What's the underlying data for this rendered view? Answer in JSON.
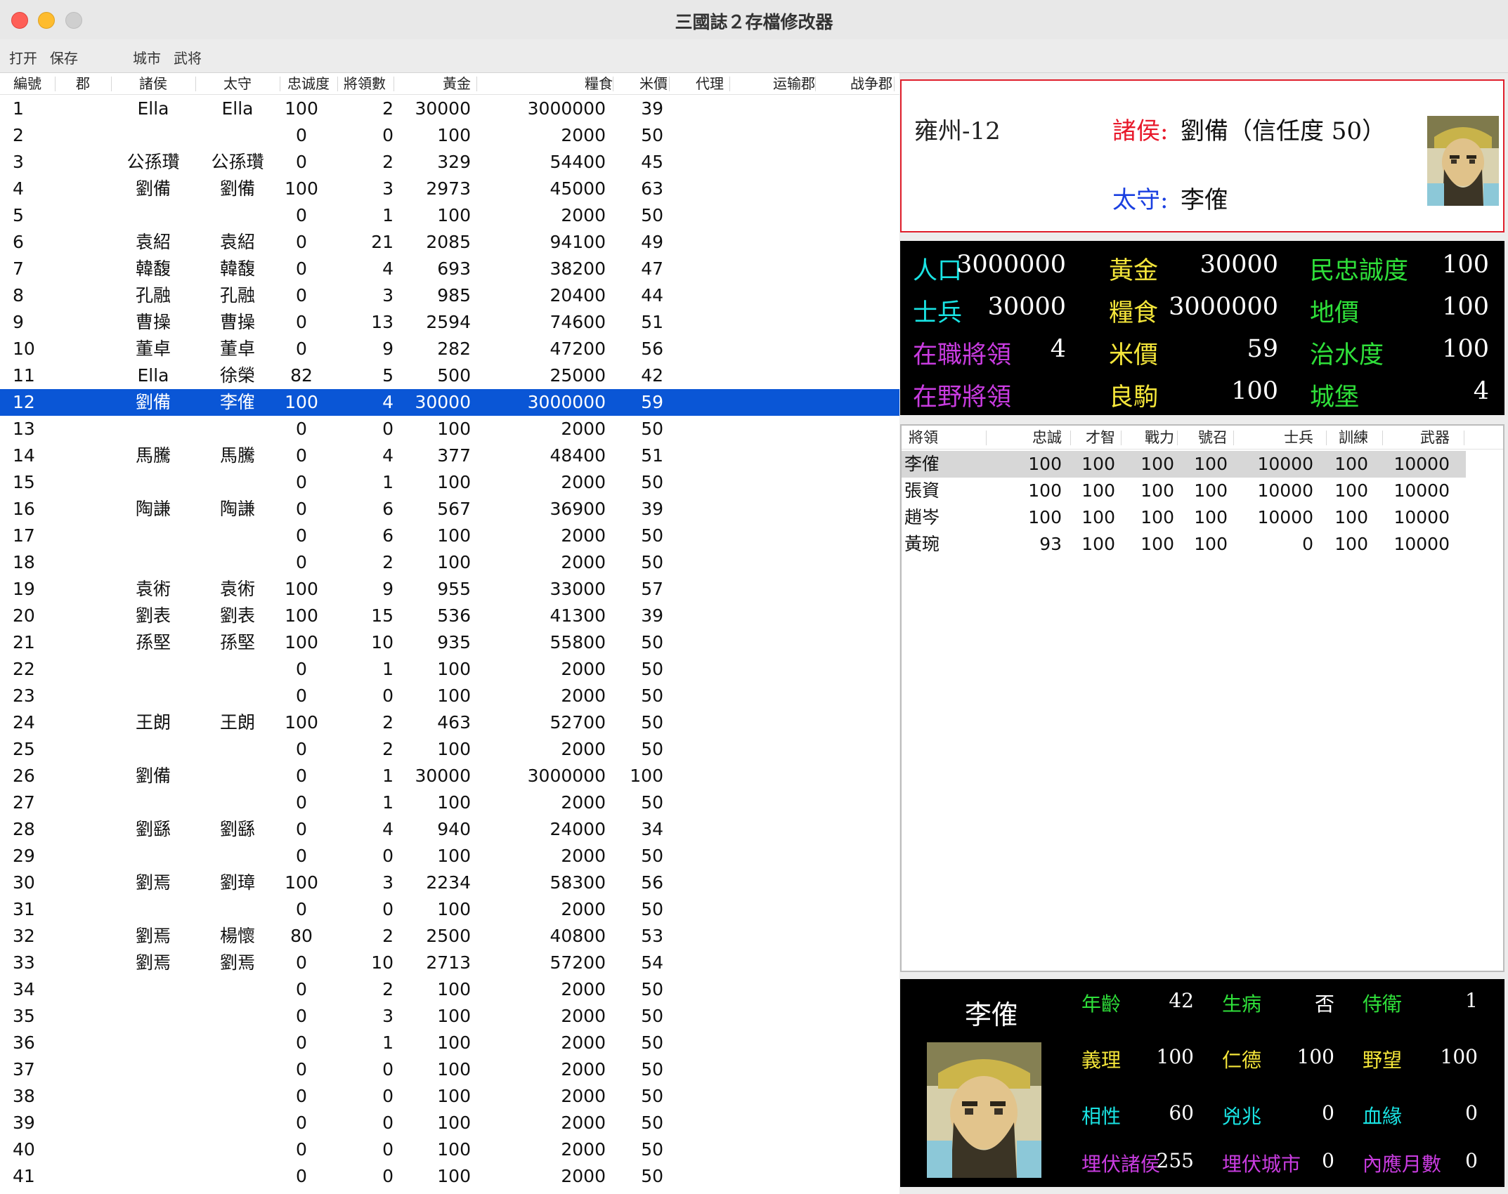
{
  "window": {
    "title": "三國誌２存檔修改器"
  },
  "menu": {
    "open": "打开",
    "save": "保存",
    "cities": "城市",
    "generals": "武将"
  },
  "city_table": {
    "columns": [
      "編號",
      "郡",
      "諸侯",
      "太守",
      "忠诚度",
      "將領數",
      "黃金",
      "糧食",
      "米價",
      "代理",
      "运输郡",
      "战争郡"
    ],
    "selected_row": 11,
    "rows": [
      [
        "1",
        "",
        "Ella",
        "Ella",
        "100",
        "2",
        "30000",
        "3000000",
        "39"
      ],
      [
        "2",
        "",
        "",
        "",
        "0",
        "0",
        "100",
        "2000",
        "50"
      ],
      [
        "3",
        "",
        "公孫瓚",
        "公孫瓚",
        "0",
        "2",
        "329",
        "54400",
        "45"
      ],
      [
        "4",
        "",
        "劉備",
        "劉備",
        "100",
        "3",
        "2973",
        "45000",
        "63"
      ],
      [
        "5",
        "",
        "",
        "",
        "0",
        "1",
        "100",
        "2000",
        "50"
      ],
      [
        "6",
        "",
        "袁紹",
        "袁紹",
        "0",
        "21",
        "2085",
        "94100",
        "49"
      ],
      [
        "7",
        "",
        "韓馥",
        "韓馥",
        "0",
        "4",
        "693",
        "38200",
        "47"
      ],
      [
        "8",
        "",
        "孔融",
        "孔融",
        "0",
        "3",
        "985",
        "20400",
        "44"
      ],
      [
        "9",
        "",
        "曹操",
        "曹操",
        "0",
        "13",
        "2594",
        "74600",
        "51"
      ],
      [
        "10",
        "",
        "董卓",
        "董卓",
        "0",
        "9",
        "282",
        "47200",
        "56"
      ],
      [
        "11",
        "",
        "Ella",
        "徐榮",
        "82",
        "5",
        "500",
        "25000",
        "42"
      ],
      [
        "12",
        "",
        "劉備",
        "李傕",
        "100",
        "4",
        "30000",
        "3000000",
        "59"
      ],
      [
        "13",
        "",
        "",
        "",
        "0",
        "0",
        "100",
        "2000",
        "50"
      ],
      [
        "14",
        "",
        "馬騰",
        "馬騰",
        "0",
        "4",
        "377",
        "48400",
        "51"
      ],
      [
        "15",
        "",
        "",
        "",
        "0",
        "1",
        "100",
        "2000",
        "50"
      ],
      [
        "16",
        "",
        "陶謙",
        "陶謙",
        "0",
        "6",
        "567",
        "36900",
        "39"
      ],
      [
        "17",
        "",
        "",
        "",
        "0",
        "6",
        "100",
        "2000",
        "50"
      ],
      [
        "18",
        "",
        "",
        "",
        "0",
        "2",
        "100",
        "2000",
        "50"
      ],
      [
        "19",
        "",
        "袁術",
        "袁術",
        "100",
        "9",
        "955",
        "33000",
        "57"
      ],
      [
        "20",
        "",
        "劉表",
        "劉表",
        "100",
        "15",
        "536",
        "41300",
        "39"
      ],
      [
        "21",
        "",
        "孫堅",
        "孫堅",
        "100",
        "10",
        "935",
        "55800",
        "50"
      ],
      [
        "22",
        "",
        "",
        "",
        "0",
        "1",
        "100",
        "2000",
        "50"
      ],
      [
        "23",
        "",
        "",
        "",
        "0",
        "0",
        "100",
        "2000",
        "50"
      ],
      [
        "24",
        "",
        "王朗",
        "王朗",
        "100",
        "2",
        "463",
        "52700",
        "50"
      ],
      [
        "25",
        "",
        "",
        "",
        "0",
        "2",
        "100",
        "2000",
        "50"
      ],
      [
        "26",
        "",
        "劉備",
        "",
        "0",
        "1",
        "30000",
        "3000000",
        "100"
      ],
      [
        "27",
        "",
        "",
        "",
        "0",
        "1",
        "100",
        "2000",
        "50"
      ],
      [
        "28",
        "",
        "劉繇",
        "劉繇",
        "0",
        "4",
        "940",
        "24000",
        "34"
      ],
      [
        "29",
        "",
        "",
        "",
        "0",
        "0",
        "100",
        "2000",
        "50"
      ],
      [
        "30",
        "",
        "劉焉",
        "劉璋",
        "100",
        "3",
        "2234",
        "58300",
        "56"
      ],
      [
        "31",
        "",
        "",
        "",
        "0",
        "0",
        "100",
        "2000",
        "50"
      ],
      [
        "32",
        "",
        "劉焉",
        "楊懷",
        "80",
        "2",
        "2500",
        "40800",
        "53"
      ],
      [
        "33",
        "",
        "劉焉",
        "劉焉",
        "0",
        "10",
        "2713",
        "57200",
        "54"
      ],
      [
        "34",
        "",
        "",
        "",
        "0",
        "2",
        "100",
        "2000",
        "50"
      ],
      [
        "35",
        "",
        "",
        "",
        "0",
        "3",
        "100",
        "2000",
        "50"
      ],
      [
        "36",
        "",
        "",
        "",
        "0",
        "1",
        "100",
        "2000",
        "50"
      ],
      [
        "37",
        "",
        "",
        "",
        "0",
        "0",
        "100",
        "2000",
        "50"
      ],
      [
        "38",
        "",
        "",
        "",
        "0",
        "0",
        "100",
        "2000",
        "50"
      ],
      [
        "39",
        "",
        "",
        "",
        "0",
        "0",
        "100",
        "2000",
        "50"
      ],
      [
        "40",
        "",
        "",
        "",
        "0",
        "0",
        "100",
        "2000",
        "50"
      ],
      [
        "41",
        "",
        "",
        "",
        "0",
        "0",
        "100",
        "2000",
        "50"
      ]
    ]
  },
  "city_info": {
    "name": "雍州-12",
    "lord_label": "諸侯:",
    "lord_value": "劉備（信任度 50）",
    "governor_label": "太守:",
    "governor_value": "李傕"
  },
  "city_stats": [
    {
      "label": "人口",
      "value": "3000000",
      "color": "#19e3e3"
    },
    {
      "label": "黃金",
      "value": "30000",
      "color": "#f5e63a"
    },
    {
      "label": "民忠誠度",
      "value": "100",
      "color": "#2fe03a"
    },
    {
      "label": "士兵",
      "value": "30000",
      "color": "#19e3e3"
    },
    {
      "label": "糧食",
      "value": "3000000",
      "color": "#f5e63a"
    },
    {
      "label": "地價",
      "value": "100",
      "color": "#2fe03a"
    },
    {
      "label": "在職將領",
      "value": "4",
      "color": "#c93ce0"
    },
    {
      "label": "米價",
      "value": "59",
      "color": "#f5e63a"
    },
    {
      "label": "治水度",
      "value": "100",
      "color": "#2fe03a"
    },
    {
      "label": "在野將領",
      "value": "",
      "color": "#c93ce0"
    },
    {
      "label": "良駒",
      "value": "100",
      "color": "#f5e63a"
    },
    {
      "label": "城堡",
      "value": "4",
      "color": "#2fe03a"
    }
  ],
  "general_table": {
    "columns": [
      "將領",
      "忠誠",
      "才智",
      "戰力",
      "號召",
      "士兵",
      "訓練",
      "武器"
    ],
    "selected_row": 0,
    "rows": [
      [
        "李傕",
        "100",
        "100",
        "100",
        "100",
        "10000",
        "100",
        "10000"
      ],
      [
        "張資",
        "100",
        "100",
        "100",
        "100",
        "10000",
        "100",
        "10000"
      ],
      [
        "趙岑",
        "100",
        "100",
        "100",
        "100",
        "10000",
        "100",
        "10000"
      ],
      [
        "黃琬",
        "93",
        "100",
        "100",
        "100",
        "0",
        "100",
        "10000"
      ]
    ]
  },
  "general_detail": {
    "name": "李傕",
    "attrs": [
      {
        "label": "年齡",
        "value": "42",
        "color": "#2fe03a"
      },
      {
        "label": "生病",
        "value": "否",
        "color": "#2fe03a"
      },
      {
        "label": "侍衛",
        "value": "1",
        "color": "#2fe03a"
      },
      {
        "label": "義理",
        "value": "100",
        "color": "#f5e63a"
      },
      {
        "label": "仁德",
        "value": "100",
        "color": "#f5e63a"
      },
      {
        "label": "野望",
        "value": "100",
        "color": "#f5e63a"
      },
      {
        "label": "相性",
        "value": "60",
        "color": "#19e3e3"
      },
      {
        "label": "兇兆",
        "value": "0",
        "color": "#19e3e3"
      },
      {
        "label": "血緣",
        "value": "0",
        "color": "#19e3e3"
      },
      {
        "label": "埋伏諸侯",
        "value": "255",
        "color": "#c93ce0"
      },
      {
        "label": "埋伏城市",
        "value": "0",
        "color": "#c93ce0"
      },
      {
        "label": "內應月數",
        "value": "0",
        "color": "#c93ce0"
      }
    ]
  }
}
